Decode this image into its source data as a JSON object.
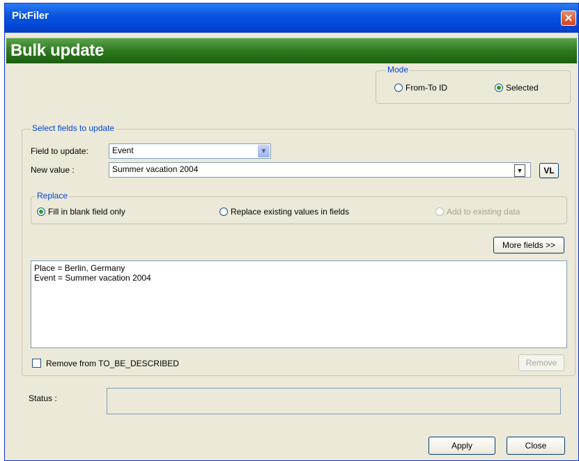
{
  "window": {
    "title": "PixFiler",
    "close_icon": "close-icon"
  },
  "banner": {
    "title": "Bulk update"
  },
  "mode": {
    "legend": "Mode",
    "options": [
      {
        "label": "From-To ID",
        "checked": false
      },
      {
        "label": "Selected",
        "checked": true
      }
    ]
  },
  "select_fields": {
    "legend": "Select fields to update",
    "field_label": "Field to update:",
    "field_value": "Event",
    "new_value_label": "New value :",
    "new_value": "Summer vacation 2004",
    "vl_button": "VL"
  },
  "replace": {
    "legend": "Replace",
    "options": [
      {
        "label": "Fill in blank field only",
        "checked": true,
        "enabled": true
      },
      {
        "label": "Replace existing values in fields",
        "checked": false,
        "enabled": true
      },
      {
        "label": "Add to existing data",
        "checked": false,
        "enabled": false
      }
    ]
  },
  "more_fields_button": "More fields >>",
  "updates_list": [
    "Place = Berlin, Germany",
    "Event = Summer vacation 2004"
  ],
  "remove_checkbox_label": "Remove from TO_BE_DESCRIBED",
  "remove_button": "Remove",
  "status": {
    "label": "Status :",
    "value": ""
  },
  "buttons": {
    "apply": "Apply",
    "close": "Close"
  },
  "colors": {
    "title_blue": "#0045d4",
    "banner_green": "#2e7a1f",
    "legend_blue": "#0046d5",
    "dialog_bg": "#ECE9D8"
  }
}
